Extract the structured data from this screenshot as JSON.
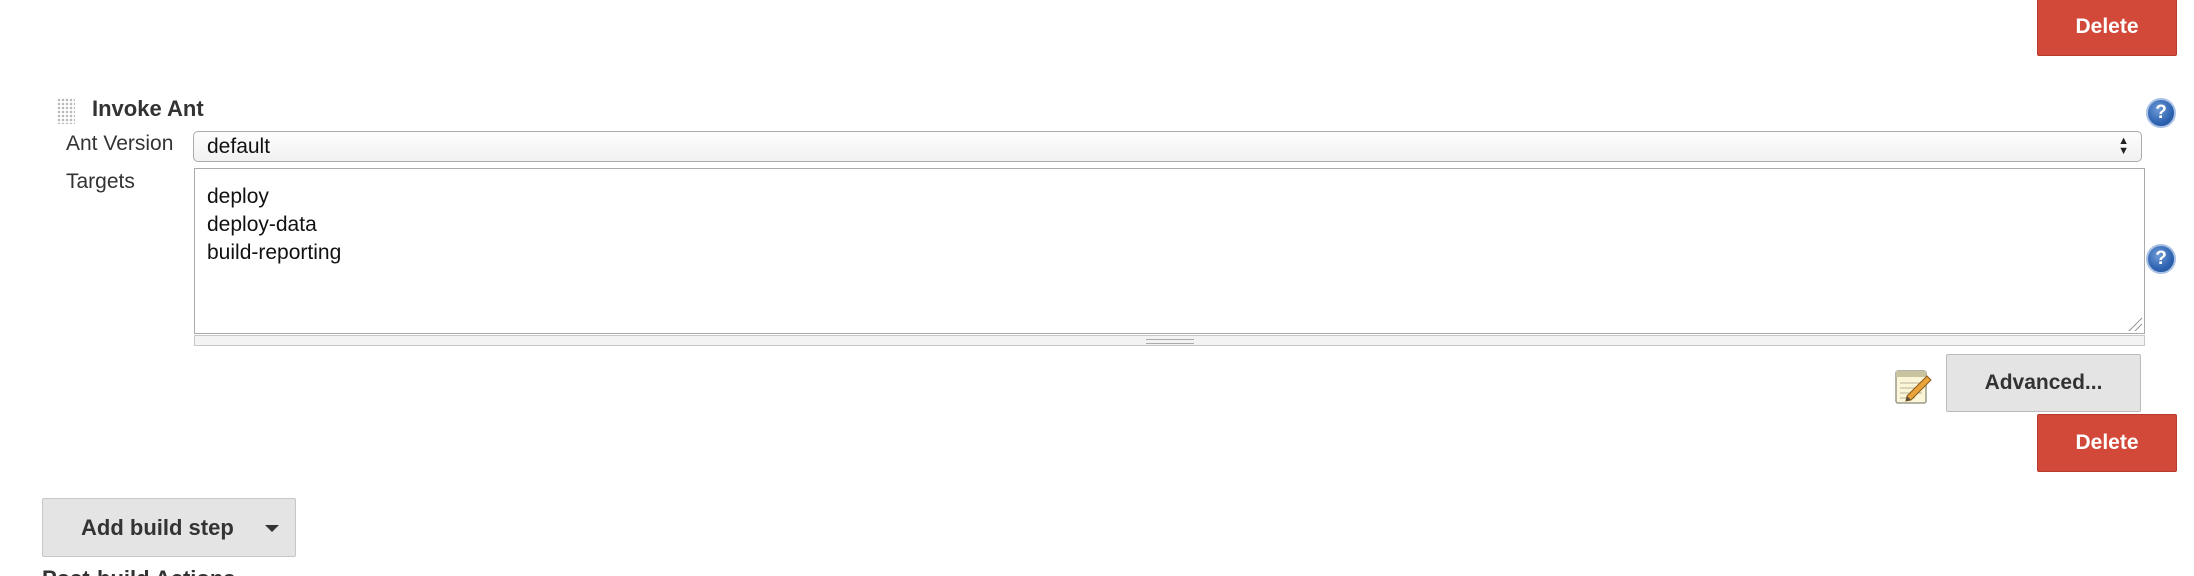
{
  "delete_label": "Delete",
  "build_step": {
    "title": "Invoke Ant",
    "ant_version": {
      "label": "Ant Version",
      "value": "default"
    },
    "targets": {
      "label": "Targets",
      "lines": [
        "deploy",
        "deploy-data",
        "build-reporting"
      ]
    },
    "advanced_label": "Advanced...",
    "help_icon_text": "?"
  },
  "add_build_step": {
    "label": "Add build step"
  },
  "next_section_title_partial": "Post-build Actions",
  "colors": {
    "delete_bg": "#d24939",
    "button_bg": "#e4e4e4",
    "help_icon": "#2e63b1"
  },
  "icons": {
    "drag_handle": "drag-handle-icon",
    "help": "help-icon",
    "notepad": "notepad-pencil-icon",
    "dropdown": "chevron-down-icon",
    "select_arrows": "up-down-arrows-icon"
  }
}
